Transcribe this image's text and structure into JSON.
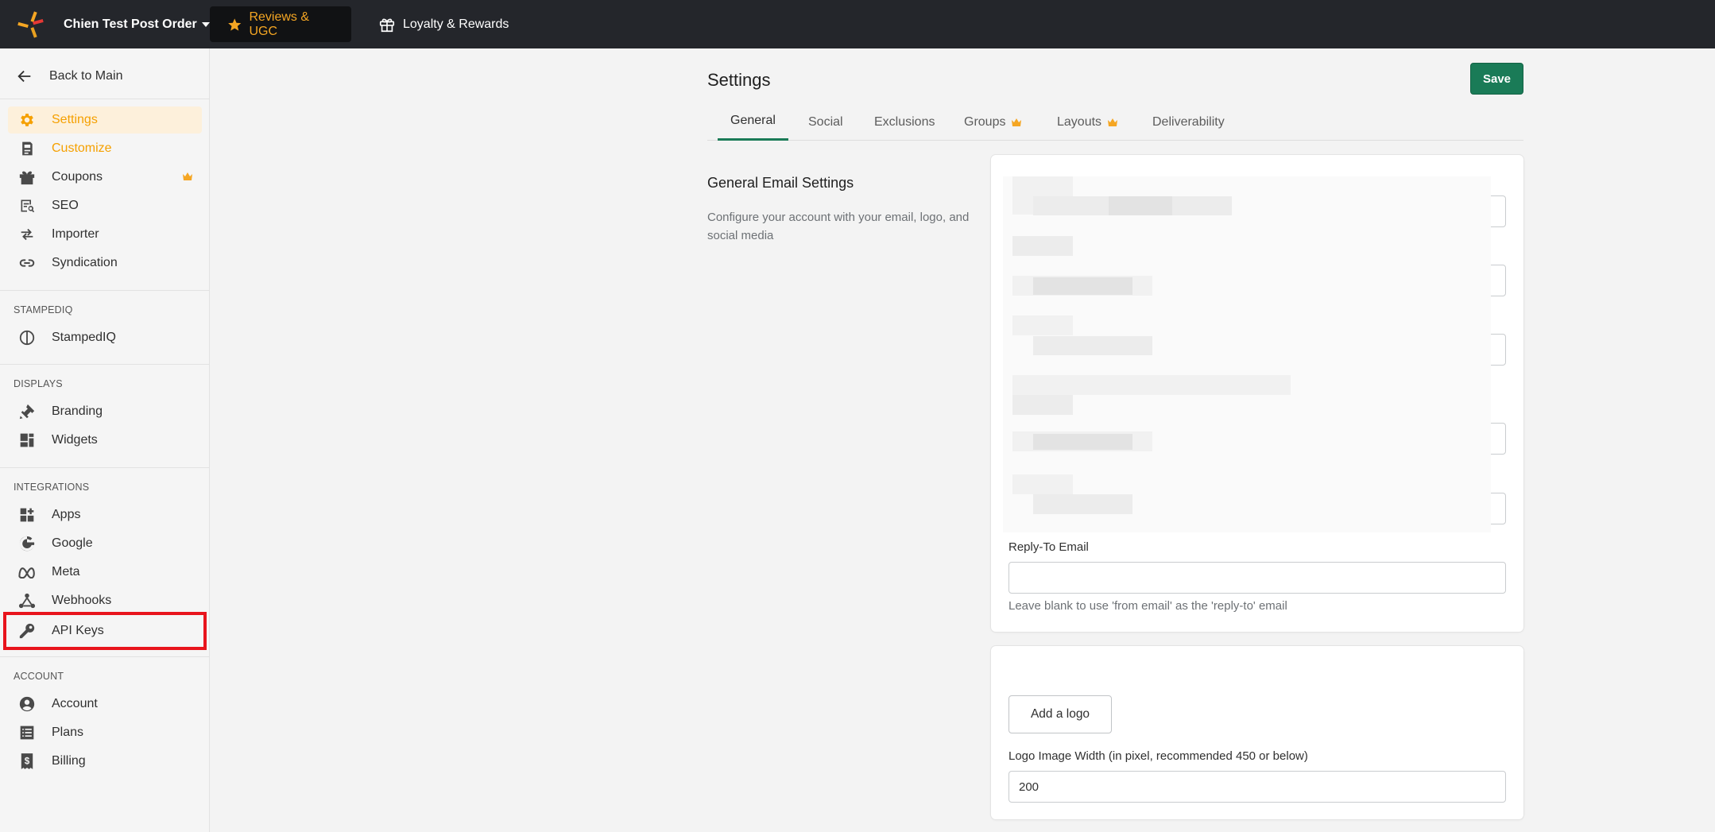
{
  "topbar": {
    "store_name": "Chien Test Post Order",
    "apps": [
      {
        "label": "Reviews & UGC",
        "icon": "star-icon",
        "active": true
      },
      {
        "label": "Loyalty & Rewards",
        "icon": "gift-icon",
        "active": false
      }
    ]
  },
  "sidebar": {
    "back_label": "Back to Main",
    "main_items": [
      {
        "label": "Settings",
        "icon": "gear-icon",
        "active": true
      },
      {
        "label": "Customize",
        "icon": "customize-icon"
      },
      {
        "label": "Coupons",
        "icon": "gift-icon",
        "premium": true
      },
      {
        "label": "SEO",
        "icon": "seo-icon"
      },
      {
        "label": "Importer",
        "icon": "import-icon"
      },
      {
        "label": "Syndication",
        "icon": "link-icon"
      }
    ],
    "stampediq_label": "STAMPEDIQ",
    "stampediq_items": [
      {
        "label": "StampedIQ",
        "icon": "stampediq-icon"
      }
    ],
    "displays_label": "DISPLAYS",
    "display_items": [
      {
        "label": "Branding",
        "icon": "brush-icon"
      },
      {
        "label": "Widgets",
        "icon": "widgets-icon"
      }
    ],
    "integrations_label": "INTEGRATIONS",
    "integration_items": [
      {
        "label": "Apps",
        "icon": "apps-icon"
      },
      {
        "label": "Google",
        "icon": "google-icon"
      },
      {
        "label": "Meta",
        "icon": "meta-icon"
      },
      {
        "label": "Webhooks",
        "icon": "webhook-icon"
      },
      {
        "label": "API Keys",
        "icon": "key-icon",
        "highlighted": true
      }
    ],
    "account_label": "ACCOUNT",
    "account_items": [
      {
        "label": "Account",
        "icon": "user-icon"
      },
      {
        "label": "Plans",
        "icon": "list-icon"
      },
      {
        "label": "Billing",
        "icon": "receipt-icon"
      }
    ]
  },
  "page": {
    "title": "Settings",
    "save_label": "Save",
    "tabs": [
      {
        "label": "General",
        "active": true
      },
      {
        "label": "Social"
      },
      {
        "label": "Exclusions"
      },
      {
        "label": "Groups",
        "premium": true
      },
      {
        "label": "Layouts",
        "premium": true
      },
      {
        "label": "Deliverability"
      }
    ],
    "section_title": "General Email Settings",
    "section_desc": "Configure your account with your email, logo, and social media",
    "reply_to": {
      "label": "Reply-To Email",
      "value": "",
      "help": "Leave blank to use 'from email' as the 'reply-to' email"
    },
    "logo": {
      "button_label": "Add a logo",
      "width_label": "Logo Image Width (in pixel, recommended 450 or below)",
      "width_value": "200"
    }
  },
  "colors": {
    "accent": "#f5a623",
    "primary": "#1a7b57",
    "topbar": "#24262b",
    "highlight": "#e8141c"
  }
}
